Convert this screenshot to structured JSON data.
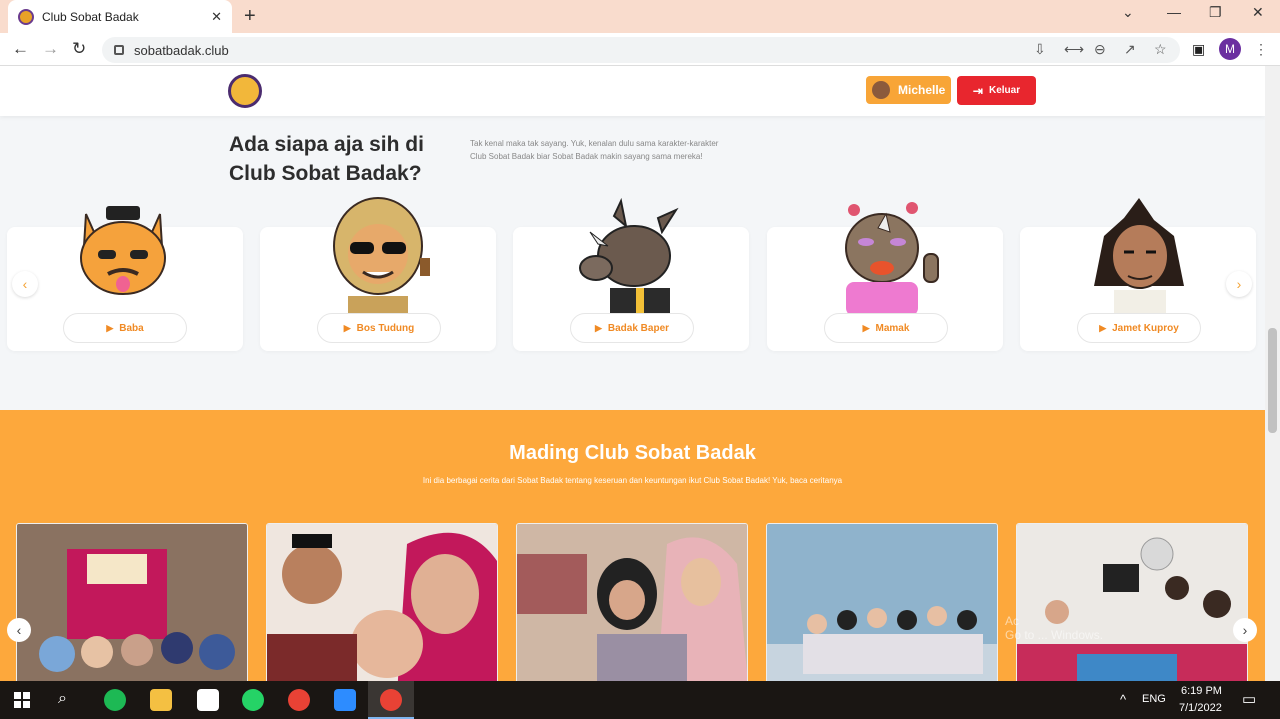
{
  "browser": {
    "tab_title": "Club Sobat Badak",
    "tab_close": "✕",
    "new_tab": "+",
    "url": "sobatbadak.club",
    "profile_initial": "M",
    "window_controls": [
      "⌄",
      "—",
      "❐",
      "✕"
    ]
  },
  "header": {
    "user_name": "Michelle",
    "logout_label": "Keluar"
  },
  "hero": {
    "title": "Ada siapa aja sih di Club Sobat Badak?",
    "description": "Tak kenal maka tak sayang. Yuk, kenalan dulu sama karakter-karakter Club Sobat Badak biar Sobat Badak makin sayang sama mereka!"
  },
  "characters": [
    {
      "name": "Baba",
      "color": "#f5a23c"
    },
    {
      "name": "Bos Tudung",
      "color": "#c9a25a"
    },
    {
      "name": "Badak Baper",
      "color": "#6b5a4e"
    },
    {
      "name": "Mamak",
      "color": "#8b7560"
    },
    {
      "name": "Jamet Kuproy",
      "color": "#3a2a22"
    }
  ],
  "mading": {
    "title": "Mading Club Sobat Badak",
    "subtitle": "Ini dia berbagai cerita dari Sobat Badak tentang keseruan dan keuntungan ikut Club Sobat Badak! Yuk, baca ceritanya",
    "photos": [
      {
        "color": "#9a7d6a"
      },
      {
        "color": "#c2185b"
      },
      {
        "color": "#b98a80"
      },
      {
        "color": "#8db0c8"
      },
      {
        "color": "#d8d4cf"
      }
    ]
  },
  "watermark": [
    "Ac",
    "Go to ... Windows."
  ],
  "taskbar": {
    "lang": "ENG",
    "time": "6:19 PM",
    "date": "7/1/2022"
  },
  "colors": {
    "accent_orange": "#fda83c",
    "logout_red": "#e8262e",
    "tab_bar": "#f9dccd"
  }
}
